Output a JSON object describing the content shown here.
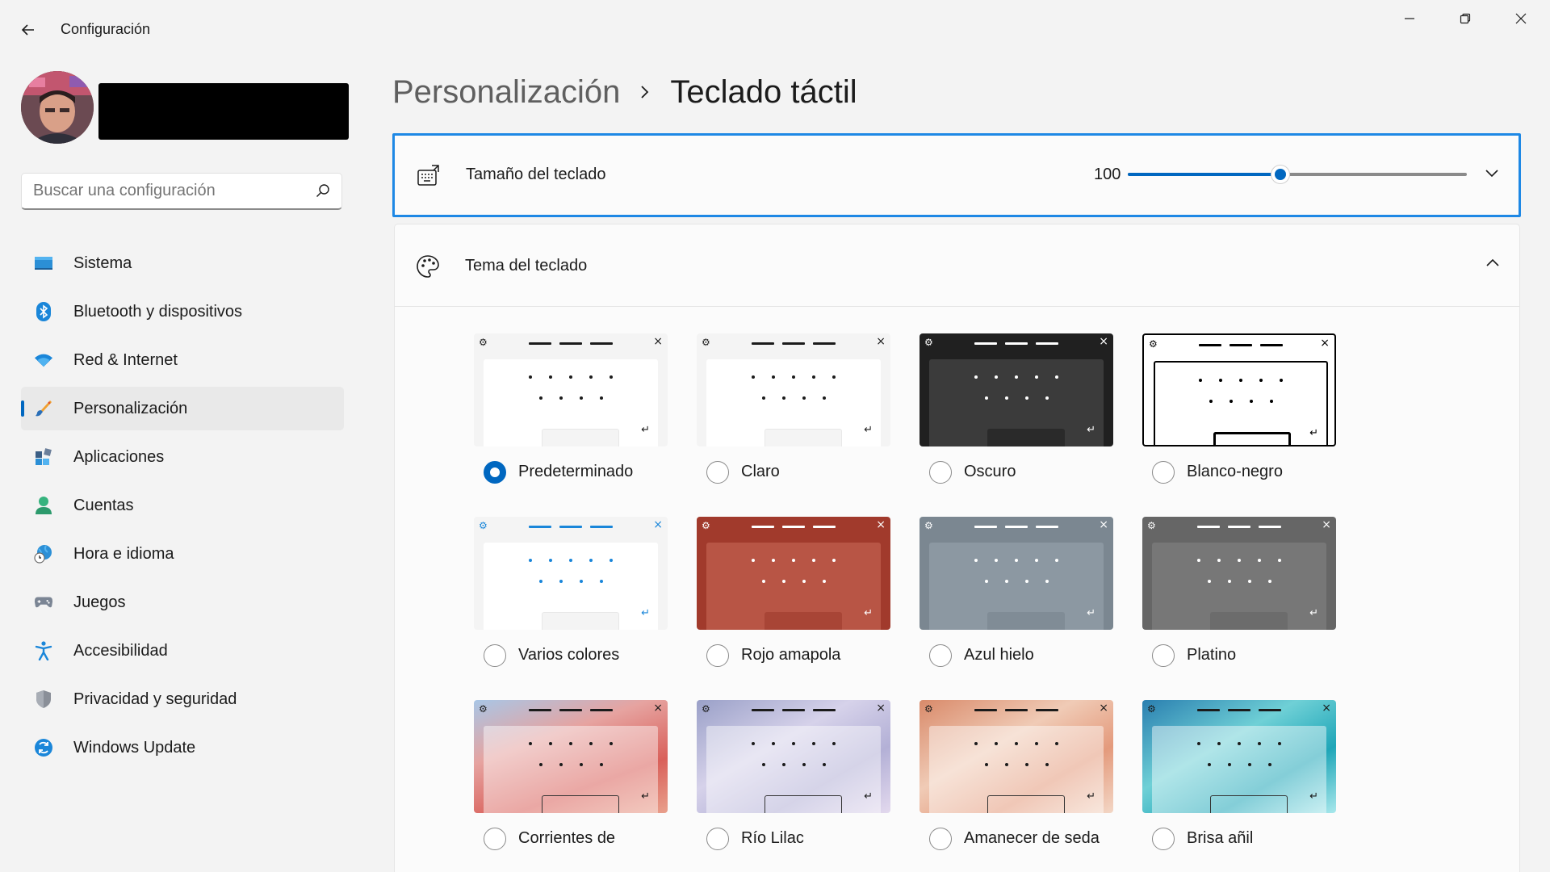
{
  "app": {
    "title": "Configuración",
    "window_controls": {
      "minimize": "minimize-icon",
      "maximize": "restore-icon",
      "close": "close-icon"
    }
  },
  "search": {
    "placeholder": "Buscar una configuración"
  },
  "sidebar": {
    "items": [
      {
        "label": "Sistema",
        "icon": "monitor-icon",
        "active": false
      },
      {
        "label": "Bluetooth y dispositivos",
        "icon": "bluetooth-icon",
        "active": false
      },
      {
        "label": "Red & Internet",
        "icon": "wifi-icon",
        "active": false
      },
      {
        "label": "Personalización",
        "icon": "brush-icon",
        "active": true
      },
      {
        "label": "Aplicaciones",
        "icon": "apps-icon",
        "active": false
      },
      {
        "label": "Cuentas",
        "icon": "person-icon",
        "active": false
      },
      {
        "label": "Hora e idioma",
        "icon": "globe-clock-icon",
        "active": false
      },
      {
        "label": "Juegos",
        "icon": "gamepad-icon",
        "active": false
      },
      {
        "label": "Accesibilidad",
        "icon": "accessibility-icon",
        "active": false
      },
      {
        "label": "Privacidad y seguridad",
        "icon": "shield-icon",
        "active": false
      },
      {
        "label": "Windows Update",
        "icon": "update-icon",
        "active": false
      }
    ]
  },
  "header": {
    "parent": "Personalización",
    "current": "Teclado táctil"
  },
  "keyboard_size": {
    "label": "Tamaño del teclado",
    "value": "100",
    "slider_fraction": 0.45
  },
  "keyboard_theme": {
    "label": "Tema del teclado",
    "themes": [
      {
        "label": "Predeterminado",
        "selected": true
      },
      {
        "label": "Claro",
        "selected": false
      },
      {
        "label": "Oscuro",
        "selected": false
      },
      {
        "label": "Blanco-negro",
        "selected": false
      },
      {
        "label": "Varios colores",
        "selected": false
      },
      {
        "label": "Rojo amapola",
        "selected": false
      },
      {
        "label": "Azul hielo",
        "selected": false
      },
      {
        "label": "Platino",
        "selected": false
      },
      {
        "label": "Corrientes de",
        "selected": false
      },
      {
        "label": "Río Lilac",
        "selected": false
      },
      {
        "label": "Amanecer de seda",
        "selected": false
      },
      {
        "label": "Brisa añil",
        "selected": false
      }
    ]
  },
  "colors": {
    "accent": "#0067c0",
    "focus_border": "#1e88e5",
    "background": "#f3f3f3",
    "card": "#fbfbfb"
  }
}
